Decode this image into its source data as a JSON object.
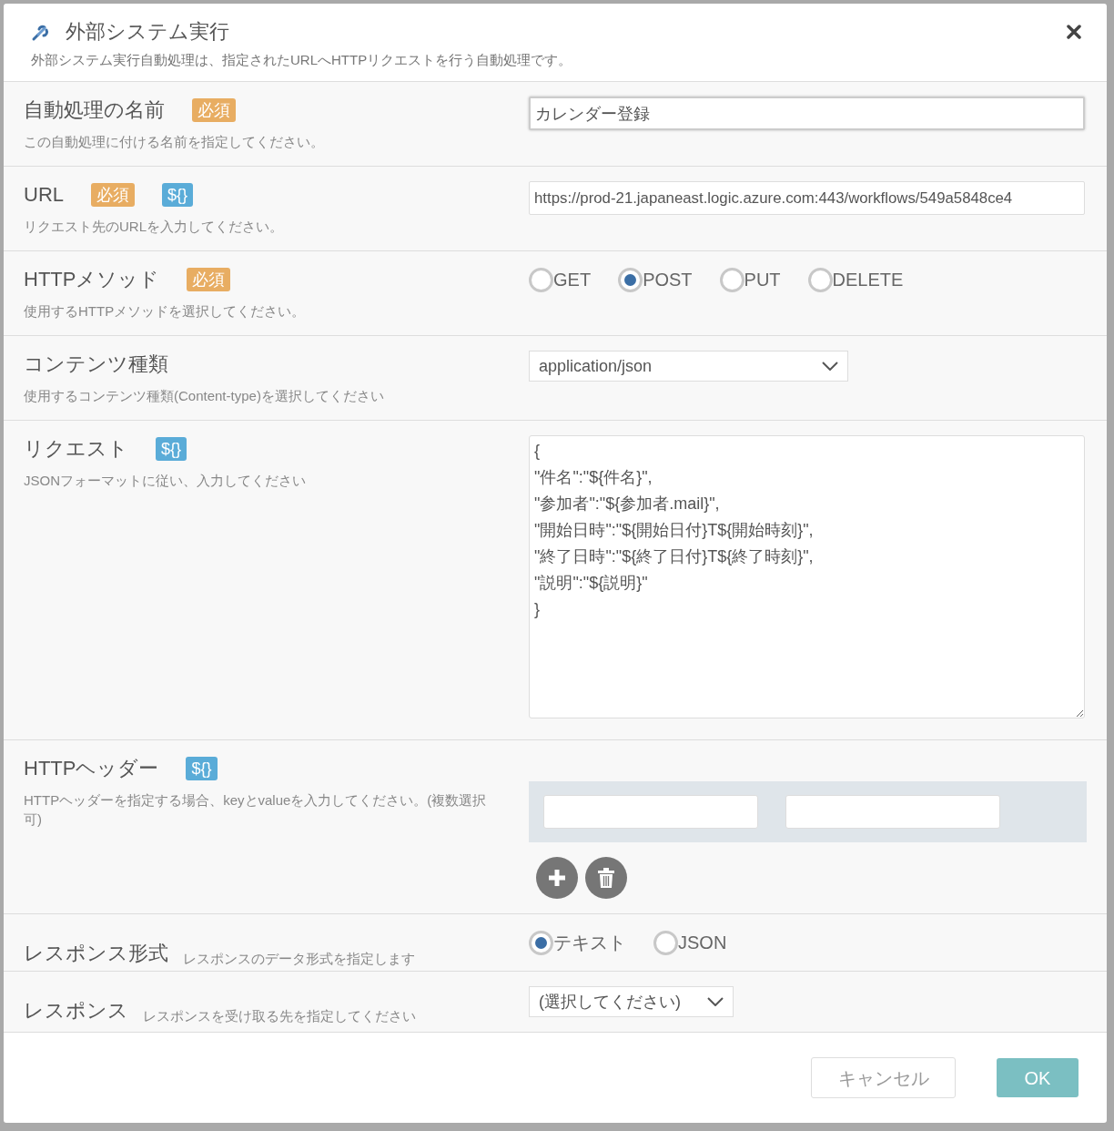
{
  "dialog": {
    "title": "外部システム実行",
    "description": "外部システム実行自動処理は、指定されたURLへHTTPリクエストを行う自動処理です。"
  },
  "fields": [
    {
      "kind": "text",
      "label": "自動処理の名前",
      "badges": [
        {
          "kind": "required",
          "text": "必須"
        }
      ],
      "help": "この自動処理に付ける名前を指定してください。",
      "value": "カレンダー登録",
      "focused": true
    },
    {
      "kind": "text",
      "label": "URL",
      "badges": [
        {
          "kind": "required",
          "text": "必須"
        },
        {
          "kind": "variable",
          "text": "${}"
        }
      ],
      "help": "リクエスト先のURLを入力してください。",
      "value": "https://prod-21.japaneast.logic.azure.com:443/workflows/549a5848ce4",
      "focused": false
    },
    {
      "kind": "radio",
      "label": "HTTPメソッド",
      "badges": [
        {
          "kind": "required",
          "text": "必須"
        }
      ],
      "help": "使用するHTTPメソッドを選択してください。",
      "options": [
        {
          "label": "GET",
          "selected": false
        },
        {
          "label": "POST",
          "selected": true
        },
        {
          "label": "PUT",
          "selected": false
        },
        {
          "label": "DELETE",
          "selected": false
        }
      ]
    },
    {
      "kind": "select",
      "label": "コンテンツ種類",
      "help": "使用するコンテンツ種類(Content-type)を選択してください",
      "value": "application/json",
      "wide": true
    },
    {
      "kind": "textarea",
      "label": "リクエスト",
      "badges": [
        {
          "kind": "variable",
          "text": "${}"
        }
      ],
      "help": "JSONフォーマットに従い、入力してください",
      "value": "{\n\"件名\":\"${件名}\",\n\"参加者\":\"${参加者.mail}\",\n\"開始日時\":\"${開始日付}T${開始時刻}\",\n\"終了日時\":\"${終了日付}T${終了時刻}\",\n\"説明\":\"${説明}\"\n}"
    },
    {
      "kind": "headers",
      "label": "HTTPヘッダー",
      "badges": [
        {
          "kind": "variable",
          "text": "${}"
        }
      ],
      "help": "HTTPヘッダーを指定する場合、keyとvalueを入力してください。(複数選択可)"
    },
    {
      "kind": "radio",
      "label": "レスポンス形式",
      "inline_help": true,
      "help": "レスポンスのデータ形式を指定します",
      "options": [
        {
          "label": "テキスト",
          "selected": true
        },
        {
          "label": "JSON",
          "selected": false
        }
      ]
    },
    {
      "kind": "select",
      "label": "レスポンス",
      "inline_help": true,
      "help": "レスポンスを受け取る先を指定してください",
      "value": "(選択してください)",
      "wide": false
    }
  ],
  "buttons": [
    {
      "kind": "secondary",
      "label": "キャンセル"
    },
    {
      "kind": "primary",
      "label": "OK"
    }
  ]
}
